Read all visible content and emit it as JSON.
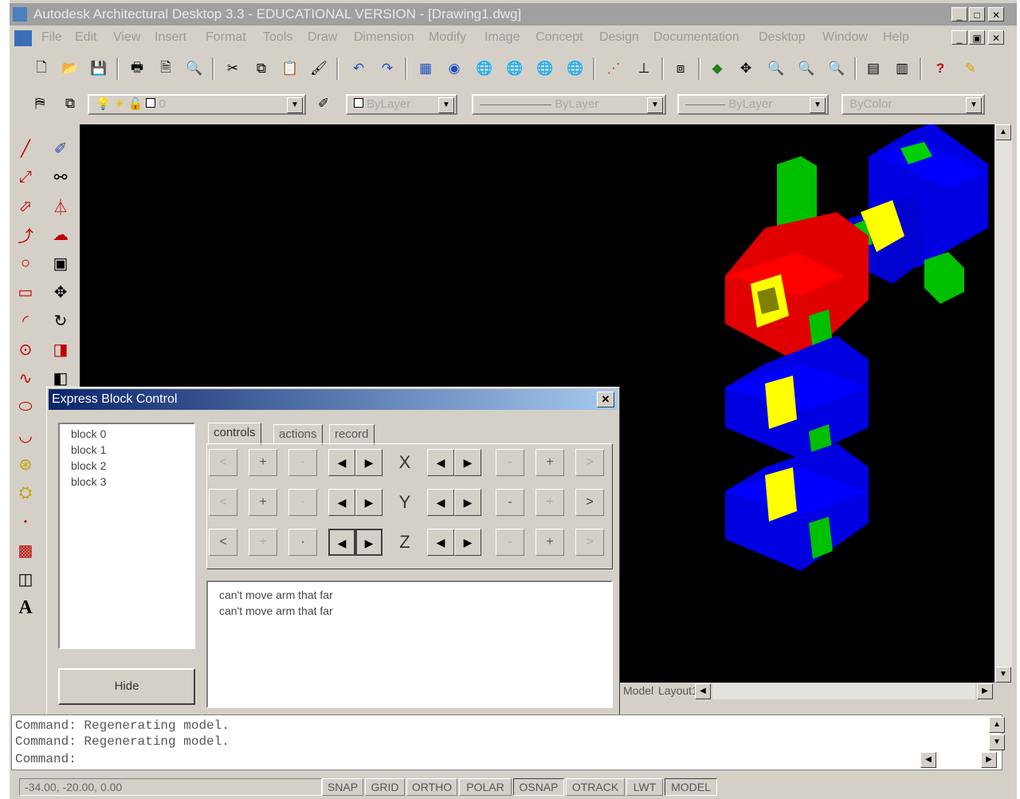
{
  "window": {
    "title": "Autodesk Architectural Desktop 3.3 - EDUCATIONAL VERSION - [Drawing1.dwg]",
    "controls": [
      "_",
      "□",
      "✕"
    ],
    "doc_controls": [
      "_",
      "▣",
      "✕"
    ]
  },
  "menu": {
    "items": [
      "File",
      "Edit",
      "View",
      "Insert",
      "Format",
      "Tools",
      "Draw",
      "Dimension",
      "Modify",
      "Image",
      "Concept",
      "Design",
      "Documentation",
      "Desktop",
      "Window",
      "Help"
    ]
  },
  "properties_bar": {
    "layer_value": "0",
    "color_value": "ByLayer",
    "linetype_value": "ByLayer",
    "lineweight_value": "ByLayer",
    "plotstyle_value": "ByColor"
  },
  "dialog": {
    "title": "Express Block Control",
    "close_label": "✕",
    "blocks": [
      "block 0",
      "block 1",
      "block 2",
      "block 3"
    ],
    "hide_label": "Hide",
    "tabs": [
      "controls",
      "actions",
      "record"
    ],
    "axes": [
      "X",
      "Y",
      "Z"
    ],
    "buttons": {
      "lt": "<",
      "plus": "+",
      "dot": "·",
      "left": "◀",
      "right": "▶",
      "minus": "-",
      "gt": ">"
    },
    "log": [
      "can't move arm that far",
      "can't move arm that far"
    ]
  },
  "layout_tabs": {
    "items": [
      "Model",
      "Layout1"
    ]
  },
  "command": {
    "lines": [
      "Command:  Regenerating model.",
      "Command:  Regenerating model.",
      "Command:"
    ]
  },
  "status": {
    "coords": "-34.00, -20.00, 0.00",
    "toggles": [
      "SNAP",
      "GRID",
      "ORTHO",
      "POLAR",
      "OSNAP",
      "OTRACK",
      "LWT",
      "MODEL"
    ]
  },
  "colors": {
    "red": "#ff0000",
    "blue": "#0000ff",
    "green": "#00c800",
    "yellow": "#ffff00"
  }
}
